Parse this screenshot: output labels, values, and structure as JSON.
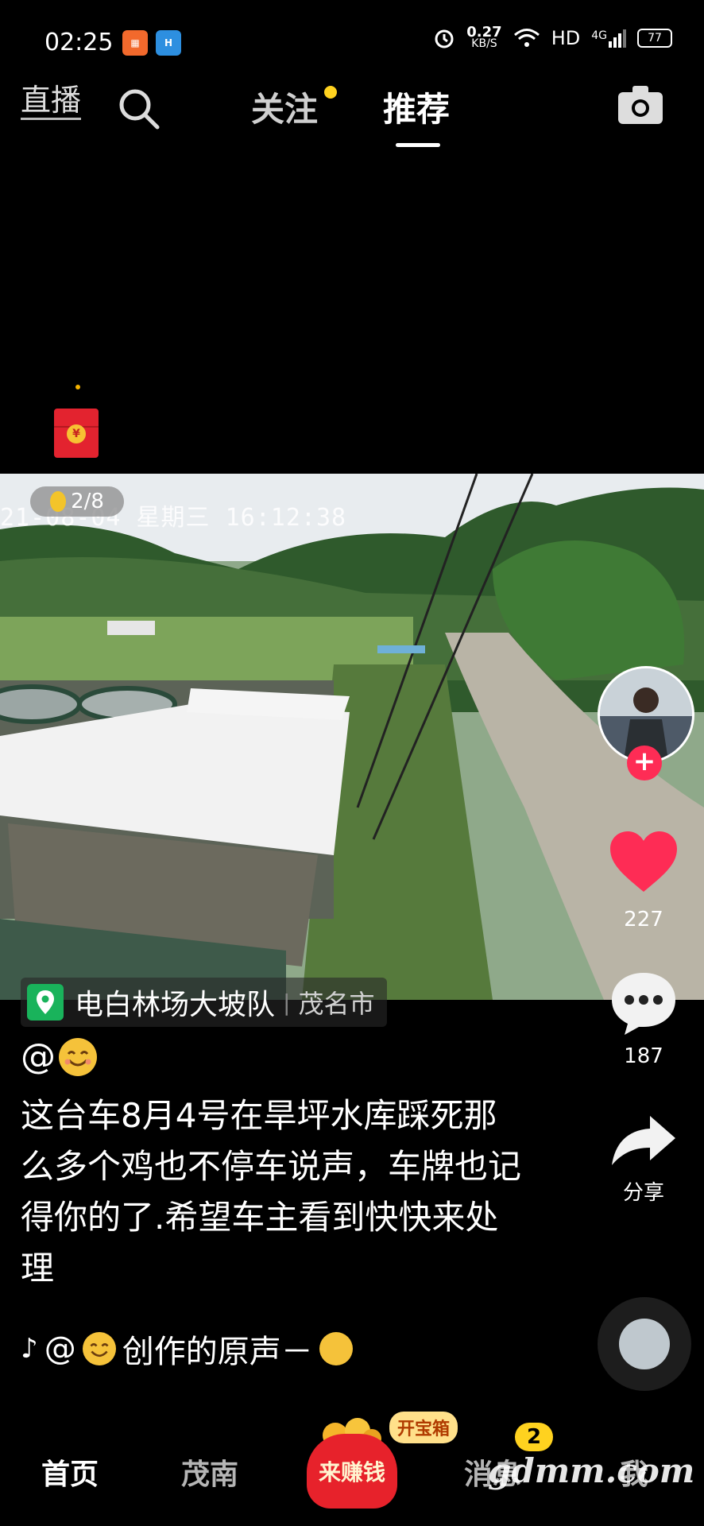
{
  "status_bar": {
    "time": "02:25",
    "net_speed_value": "0.27",
    "net_speed_unit": "KB/S",
    "hd_label": "HD",
    "signal_label": "4G",
    "battery": "77"
  },
  "top_nav": {
    "live_label": "直播",
    "tabs": [
      {
        "label": "关注",
        "has_dot": true
      },
      {
        "label": "推荐",
        "active": true
      }
    ]
  },
  "video": {
    "counter": "2/8",
    "timestamp": "21-08-04 星期三 16:12:38",
    "location": {
      "name": "电白林场大坡队",
      "city": "茂名市"
    }
  },
  "right_rail": {
    "likes": "227",
    "comments": "187",
    "share_label": "分享"
  },
  "caption": {
    "author": "@",
    "text": "这台车8月4号在旱坪水库踩死那么多个鸡也不停车说声，车牌也记得你的了.希望车主看到快快来处理"
  },
  "music": {
    "prefix": "@",
    "text": "创作的原声－"
  },
  "bottom_nav": {
    "home": "首页",
    "local": "茂南",
    "earn": "来赚钱",
    "treasure_badge": "开宝箱",
    "messages": "消息",
    "messages_count": "2",
    "me": "我"
  },
  "watermark": "gdmm.com",
  "colors": {
    "accent_yellow": "#ffd21f",
    "like_red": "#fe2c55",
    "earn_red": "#e7222b",
    "location_green": "#19b35b"
  }
}
